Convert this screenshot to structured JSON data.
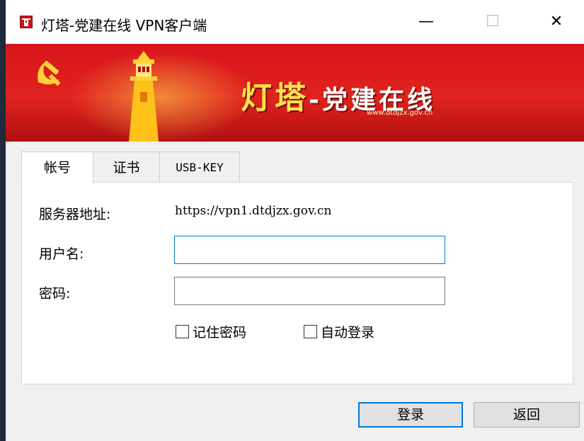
{
  "window": {
    "title": "灯塔-党建在线 VPN客户端",
    "controls": {
      "minimize": "—",
      "maximize": "☐",
      "close": "✕"
    }
  },
  "banner": {
    "title_main": "灯塔",
    "title_sub": "-党建在线",
    "url": "www.dtdjzx.gov.cn",
    "brand_color": "#d8151c"
  },
  "tabs": [
    {
      "label": "帐号",
      "active": true
    },
    {
      "label": "证书",
      "active": false
    },
    {
      "label": "USB-KEY",
      "active": false
    }
  ],
  "form": {
    "server_label": "服务器地址:",
    "server_value": "https://vpn1.dtdjzx.gov.cn",
    "username_label": "用户名:",
    "username_value": "",
    "password_label": "密码:",
    "password_value": "",
    "remember_label": "记住密码",
    "remember_checked": false,
    "autologin_label": "自动登录",
    "autologin_checked": false
  },
  "buttons": {
    "login": "登录",
    "back": "返回"
  },
  "colors": {
    "accent": "#0078d7",
    "banner_red": "#d8151c",
    "banner_gold": "#ffe34a"
  }
}
